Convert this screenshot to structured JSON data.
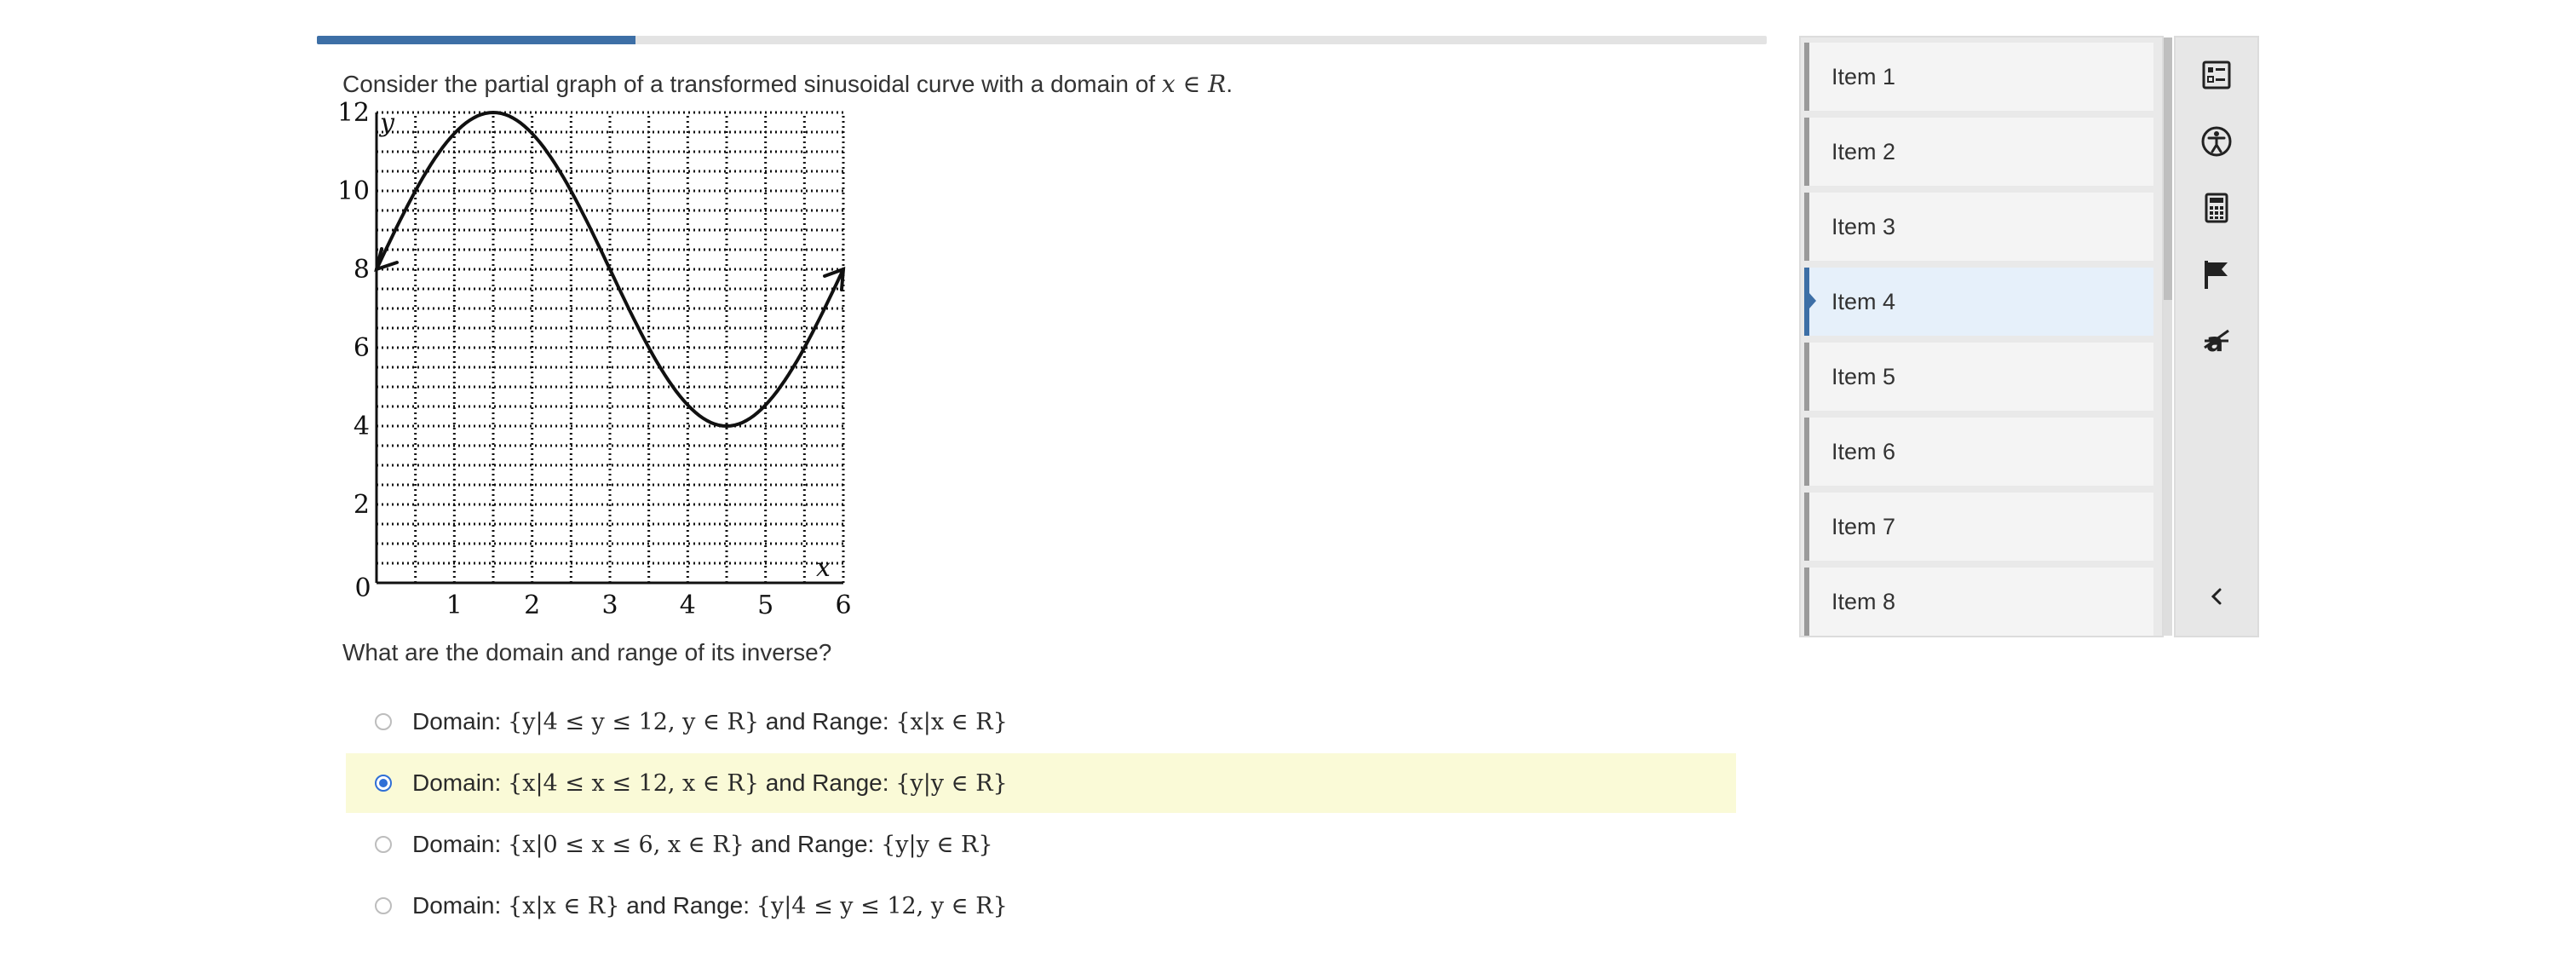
{
  "progress": {
    "fraction": 0.22
  },
  "question": {
    "intro": "Consider the partial graph of a transformed sinusoidal curve with a domain of ",
    "domain_math": "x ∈ R",
    "end": ".",
    "prompt": "What are the domain and range of its inverse?"
  },
  "graph": {
    "y_label": "y",
    "x_label": "x",
    "x_ticks": [
      "0",
      "1",
      "2",
      "3",
      "4",
      "5",
      "6"
    ],
    "y_ticks": [
      "2",
      "4",
      "6",
      "8",
      "10",
      "12"
    ]
  },
  "choices": [
    {
      "prefix": "Domain: ",
      "domain": "{y|4 ≤ y ≤ 12,  y ∈ R}",
      "mid": " and Range: ",
      "range": "{x|x ∈ R}",
      "selected": false
    },
    {
      "prefix": "Domain: ",
      "domain": "{x|4 ≤ x ≤ 12, x ∈ R}",
      "mid": " and Range: ",
      "range": "{y|y ∈ R}",
      "selected": true
    },
    {
      "prefix": "Domain: ",
      "domain": "{x|0 ≤ x ≤ 6, x ∈ R}",
      "mid": " and Range: ",
      "range": "{y|y ∈ R}",
      "selected": false
    },
    {
      "prefix": "Domain: ",
      "domain": "{x|x ∈ R}",
      "mid": " and Range: ",
      "range": "{y|4 ≤ y ≤ 12, y ∈ R}",
      "selected": false
    }
  ],
  "items": [
    "Item 1",
    "Item 2",
    "Item 3",
    "Item 4",
    "Item 5",
    "Item 6",
    "Item 7",
    "Item 8"
  ],
  "active_item": "Item 4",
  "tools": [
    "checklist-icon",
    "accessibility-icon",
    "calculator-icon",
    "flag-icon",
    "strikethrough-icon",
    "collapse-chevron-icon"
  ],
  "colors": {
    "accent": "#3d6fa6",
    "selected_bg": "#fafad7",
    "radio": "#2f6fd6"
  }
}
